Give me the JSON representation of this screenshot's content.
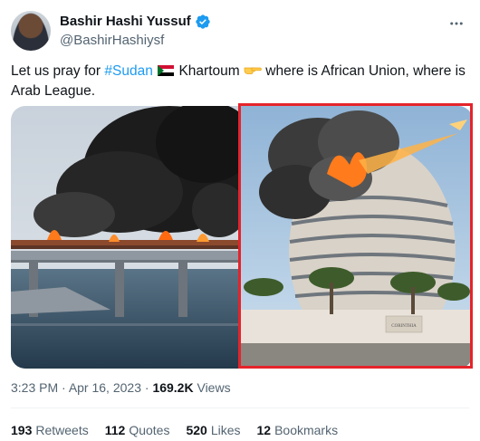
{
  "author": {
    "display_name": "Bashir Hashi Yussuf",
    "handle": "@BashirHashiysf",
    "verified": true
  },
  "tweet": {
    "text_part1": "Let us pray for ",
    "hashtag": "#Sudan",
    "text_part2": " Khartoum ",
    "text_part3": " where is African Union, where is Arab League."
  },
  "media": {
    "left_image": "bridge-fire-photo",
    "right_image": "corinthia-hotel-fire-photo",
    "highlight_color": "#e5232a",
    "hotel_sign": "CORINTHIA"
  },
  "meta": {
    "time": "3:23 PM",
    "date": "Apr 16, 2023",
    "views_count": "169.2K",
    "views_label": "Views"
  },
  "stats": {
    "retweets_count": "193",
    "retweets_label": "Retweets",
    "quotes_count": "112",
    "quotes_label": "Quotes",
    "likes_count": "520",
    "likes_label": "Likes",
    "bookmarks_count": "12",
    "bookmarks_label": "Bookmarks"
  },
  "colors": {
    "link": "#1d9bf0",
    "verified": "#1d9bf0",
    "secondary_text": "#536471"
  }
}
